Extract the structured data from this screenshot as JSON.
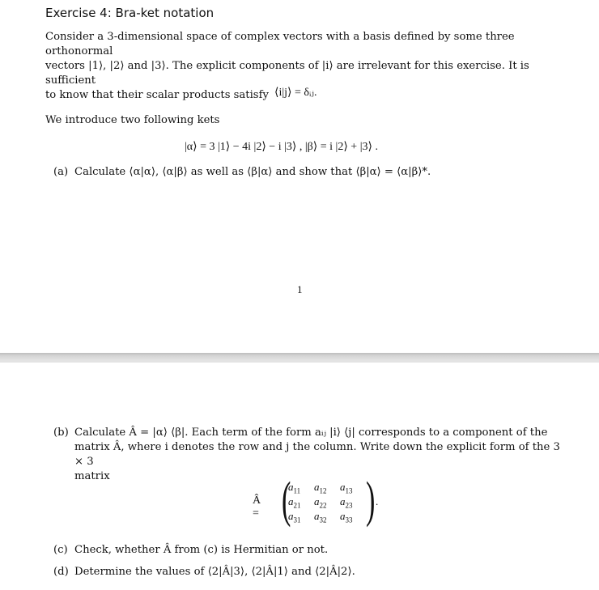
{
  "page1": {
    "title": "Exercise 4: Bra-ket notation",
    "intro_line1": "Consider a 3-dimensional space of complex vectors with a basis defined by some three orthonormal",
    "intro_line2": "vectors |1⟩, |2⟩ and |3⟩. The explicit components of |i⟩ are irrelevant for this exercise. It is sufficient",
    "intro_line3": "to know that their scalar products satisfy",
    "equation_orthonormal": "⟨i|j⟩ = δᵢⱼ.",
    "kets_intro": "We introduce two following kets",
    "equation_kets": "|α⟩ = 3 |1⟩ − 4i |2⟩ − i |3⟩ ,    |β⟩ = i |2⟩ + |3⟩ .",
    "part_a_label": "(a)",
    "part_a_text": "Calculate ⟨α|α⟩, ⟨α|β⟩ as well as ⟨β|α⟩ and show that ⟨β|α⟩ = ⟨α|β⟩*.",
    "page_number": "1"
  },
  "page2": {
    "part_b_label": "(b)",
    "part_b_line1": "Calculate Â = |α⟩ ⟨β|. Each term of the form aᵢⱼ |i⟩ ⟨j| corresponds to a component of the",
    "part_b_line2": "matrix Â, where i denotes the row and j the column. Write down the explicit form of the 3 × 3",
    "part_b_line3": "matrix",
    "matrix_lhs": "Â =",
    "matrix_entries": [
      [
        "a",
        "11"
      ],
      [
        "a",
        "12"
      ],
      [
        "a",
        "13"
      ],
      [
        "a",
        "21"
      ],
      [
        "a",
        "22"
      ],
      [
        "a",
        "23"
      ],
      [
        "a",
        "31"
      ],
      [
        "a",
        "32"
      ],
      [
        "a",
        "33"
      ]
    ],
    "matrix_trailing": ".",
    "part_c_label": "(c)",
    "part_c_text": "Check, whether Â from (c) is Hermitian or not.",
    "part_d_label": "(d)",
    "part_d_text": "Determine the values of ⟨2|Â|3⟩, ⟨2|Â|1⟩ and ⟨2|Â|2⟩."
  }
}
